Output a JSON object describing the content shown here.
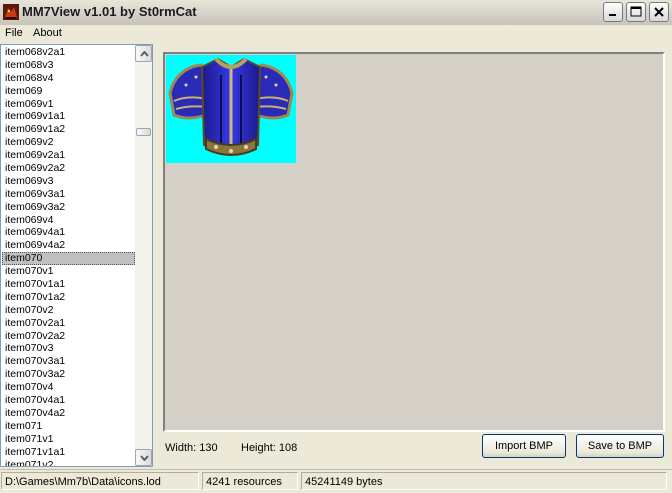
{
  "window": {
    "title": "MM7View v1.01 by St0rmCat",
    "icon": "dragon-icon",
    "controls": [
      "minimize-icon",
      "maximize-icon",
      "close-icon"
    ]
  },
  "menu": {
    "items": [
      {
        "label": "File"
      },
      {
        "label": "About"
      }
    ]
  },
  "list": {
    "items": [
      "item068v2a1",
      "item068v3",
      "item068v4",
      "item069",
      "item069v1",
      "item069v1a1",
      "item069v1a2",
      "item069v2",
      "item069v2a1",
      "item069v2a2",
      "item069v3",
      "item069v3a1",
      "item069v3a2",
      "item069v4",
      "item069v4a1",
      "item069v4a2",
      "item070",
      "item070v1",
      "item070v1a1",
      "item070v1a2",
      "item070v2",
      "item070v2a1",
      "item070v2a2",
      "item070v3",
      "item070v3a1",
      "item070v3a2",
      "item070v4",
      "item070v4a1",
      "item070v4a2",
      "item071",
      "item071v1",
      "item071v1a1",
      "item071v2"
    ],
    "selected_index": 16
  },
  "preview": {
    "background_color": "#00ffff",
    "width_label": "Width: 130",
    "height_label": "Height: 108"
  },
  "buttons": {
    "import_label": "Import BMP",
    "save_label": "Save to BMP"
  },
  "status": {
    "path": "D:\\Games\\Mm7b\\Data\\icons.lod",
    "resources": "4241 resources",
    "bytes": "45241149 bytes"
  }
}
